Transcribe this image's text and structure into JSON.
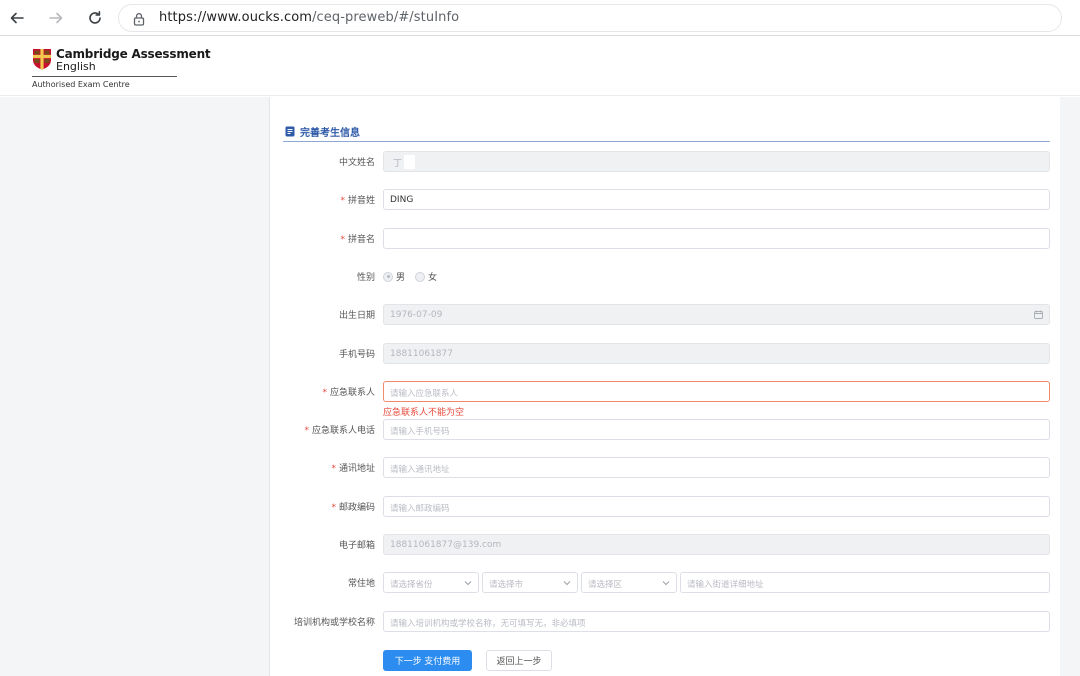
{
  "browser": {
    "url_host": "https://www.oucks.com",
    "url_path": "/ceq-preweb/#/stuInfo"
  },
  "logo": {
    "line1": "Cambridge Assessment",
    "line2": "English",
    "sub": "Authorised Exam Centre"
  },
  "section": {
    "title": "完善考生信息"
  },
  "form": {
    "chinese_name": {
      "label": "中文姓名",
      "value": "丁"
    },
    "pinyin_surname": {
      "label": "拼音姓",
      "value": "DING"
    },
    "pinyin_given": {
      "label": "拼音名",
      "value": ""
    },
    "gender": {
      "label": "性别",
      "male": "男",
      "female": "女",
      "selected": "男"
    },
    "birthdate": {
      "label": "出生日期",
      "value": "1976-07-09"
    },
    "phone": {
      "label": "手机号码",
      "value": "18811061877"
    },
    "emergency_contact": {
      "label": "应急联系人",
      "placeholder": "请输入应急联系人",
      "error": "应急联系人不能为空"
    },
    "emergency_phone": {
      "label": "应急联系人电话",
      "placeholder": "请输入手机号码"
    },
    "address": {
      "label": "通讯地址",
      "placeholder": "请输入通讯地址"
    },
    "postcode": {
      "label": "邮政编码",
      "placeholder": "请输入邮政编码"
    },
    "email": {
      "label": "电子邮箱",
      "value": "18811061877@139.com"
    },
    "residence": {
      "label": "常住地",
      "province_placeholder": "请选择省份",
      "city_placeholder": "请选择市",
      "district_placeholder": "请选择区",
      "street_placeholder": "请输入街道详细地址"
    },
    "school": {
      "label": "培训机构或学校名称",
      "placeholder": "请输入培训机构或学校名称，无可填写无，非必填项"
    }
  },
  "buttons": {
    "next": "下一步 支付费用",
    "back": "返回上一步"
  },
  "colors": {
    "primary": "#2d8cf0",
    "error": "#e8493b",
    "section_title": "#2f5aa8"
  }
}
